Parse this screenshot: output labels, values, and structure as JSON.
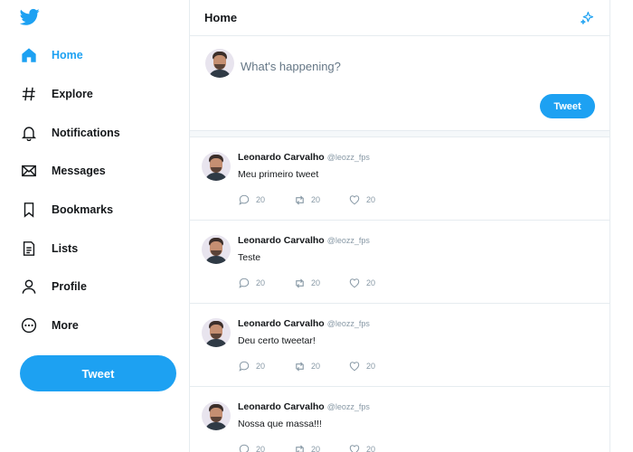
{
  "sidebar": {
    "logo_icon": "twitter-bird-icon",
    "items": [
      {
        "label": "Home",
        "icon": "home-icon",
        "active": true
      },
      {
        "label": "Explore",
        "icon": "hashtag-icon"
      },
      {
        "label": "Notifications",
        "icon": "bell-icon"
      },
      {
        "label": "Messages",
        "icon": "envelope-icon"
      },
      {
        "label": "Bookmarks",
        "icon": "bookmark-icon"
      },
      {
        "label": "Lists",
        "icon": "list-icon"
      },
      {
        "label": "Profile",
        "icon": "person-icon"
      },
      {
        "label": "More",
        "icon": "more-circle-icon"
      }
    ],
    "tweet_button": "Tweet"
  },
  "header": {
    "title": "Home",
    "icon": "sparkle-icon"
  },
  "compose": {
    "placeholder": "What's happening?",
    "tweet_button": "Tweet"
  },
  "tweets": [
    {
      "name": "Leonardo Carvalho",
      "handle": "@leozz_fps",
      "text": "Meu primeiro tweet",
      "replies": "20",
      "retweets": "20",
      "likes": "20"
    },
    {
      "name": "Leonardo Carvalho",
      "handle": "@leozz_fps",
      "text": "Teste",
      "replies": "20",
      "retweets": "20",
      "likes": "20"
    },
    {
      "name": "Leonardo Carvalho",
      "handle": "@leozz_fps",
      "text": "Deu certo tweetar!",
      "replies": "20",
      "retweets": "20",
      "likes": "20"
    },
    {
      "name": "Leonardo Carvalho",
      "handle": "@leozz_fps",
      "text": "Nossa que massa!!!",
      "replies": "20",
      "retweets": "20",
      "likes": "20"
    }
  ],
  "colors": {
    "accent": "#1da1f2",
    "text": "#14171a",
    "muted": "#8899a6",
    "border": "#e6ecf0"
  }
}
